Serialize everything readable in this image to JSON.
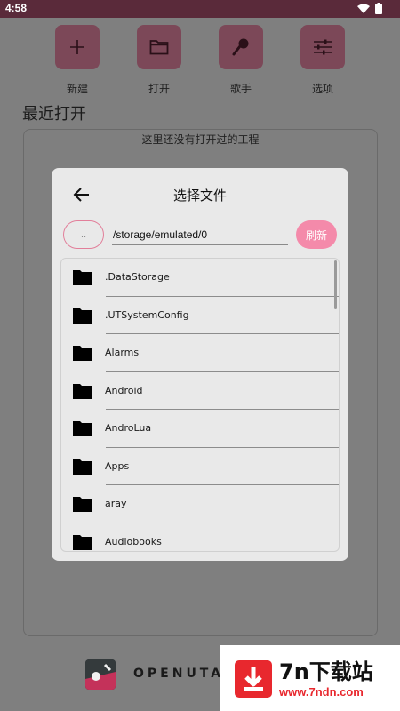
{
  "status_bar": {
    "time": "4:58"
  },
  "toolbar": {
    "new_label": "新建",
    "open_label": "打开",
    "singer_label": "歌手",
    "options_label": "选项"
  },
  "recent": {
    "title": "最近打开",
    "empty_text": "这里还没有打开过的工程"
  },
  "footer": {
    "app_name": "OPENUTA"
  },
  "watermark": {
    "title": "7n下载站",
    "url": "www.7ndn.com"
  },
  "dialog": {
    "title": "选择文件",
    "up_label": "..",
    "path": "/storage/emulated/0",
    "refresh_label": "刷新",
    "files": [
      ".DataStorage",
      ".UTSystemConfig",
      "Alarms",
      "Android",
      "AndroLua",
      "Apps",
      "aray",
      "Audiobooks"
    ]
  },
  "colors": {
    "accent": "#f48aaa",
    "toolbar_btn": "#7c4858",
    "status_bar": "#5a2a3a"
  }
}
